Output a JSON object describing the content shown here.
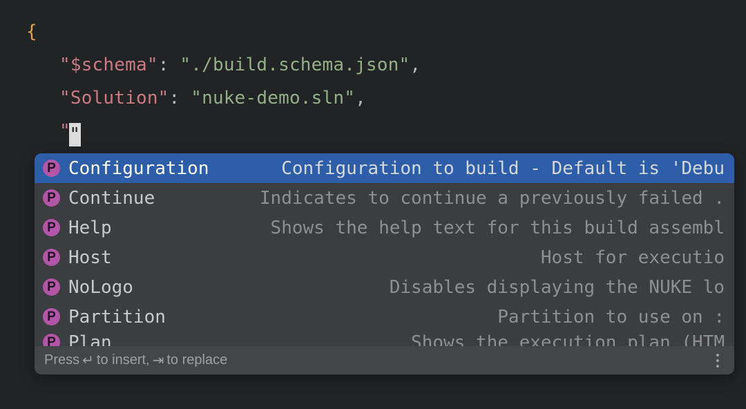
{
  "code": {
    "brace_open": "{",
    "key1": "\"$schema\"",
    "colon": ": ",
    "val1": "\"./build.schema.json\"",
    "comma": ",",
    "key2": "\"Solution\"",
    "val2": "\"nuke-demo.sln\"",
    "partial_quote_before": "\"",
    "cursor_char": "\""
  },
  "suggestions": [
    {
      "icon": "P",
      "name": "Configuration",
      "desc": "Configuration to build - Default is 'Debu"
    },
    {
      "icon": "P",
      "name": "Continue",
      "desc": "Indicates to continue a previously failed ."
    },
    {
      "icon": "P",
      "name": "Help",
      "desc": "Shows the help text for this build assembl"
    },
    {
      "icon": "P",
      "name": "Host",
      "desc": "Host for executio"
    },
    {
      "icon": "P",
      "name": "NoLogo",
      "desc": "Disables displaying the NUKE lo"
    },
    {
      "icon": "P",
      "name": "Partition",
      "desc": "Partition to use on :"
    },
    {
      "icon": "P",
      "name": "Plan",
      "desc": "Shows the execution plan (HTM"
    }
  ],
  "footer": {
    "press": "Press ",
    "insert": " to insert, ",
    "replace": " to replace"
  }
}
